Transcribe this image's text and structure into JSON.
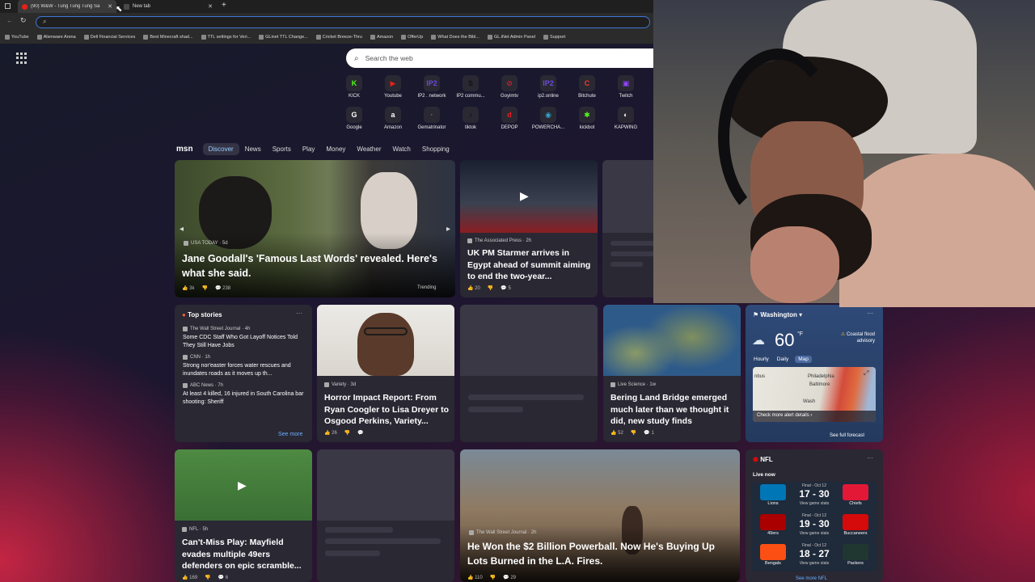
{
  "browser": {
    "tabs": [
      {
        "title": "(90) W&W - Tung Tung Tung Sa"
      },
      {
        "title": "New tab"
      }
    ],
    "bookmarks": [
      "YouTube",
      "Alienware Arena",
      "Dell Financial Services",
      "Best Minecraft shad...",
      "TTL settings for Veri...",
      "GLinet TTL Change...",
      "Cricket Breeze-Thru",
      "Amazon",
      "OfferUp",
      "What Does the Bibl...",
      "GL.iNet Admin Panel",
      "Support"
    ]
  },
  "search": {
    "placeholder": "Search the web"
  },
  "quick_links": [
    {
      "label": "KICK",
      "glyph": "K",
      "color": "#53fc18"
    },
    {
      "label": "Youtube",
      "glyph": "▶",
      "color": "#e62117"
    },
    {
      "label": "IP2 . network",
      "glyph": "IP2",
      "color": "#6b4bd6"
    },
    {
      "label": "IP2 commu...",
      "glyph": "S",
      "color": "#111111"
    },
    {
      "label": "Goyimtv",
      "glyph": "⊘",
      "color": "#cc2233"
    },
    {
      "label": "ip2.online",
      "glyph": "IP2",
      "color": "#6b4bd6"
    },
    {
      "label": "Bitchute",
      "glyph": "C",
      "color": "#ef3b2e"
    },
    {
      "label": "Twitch",
      "glyph": "▣",
      "color": "#9146ff"
    },
    {
      "label": "Google",
      "glyph": "G",
      "color": "#ffffff"
    },
    {
      "label": "Amazon",
      "glyph": "a",
      "color": "#ffffff"
    },
    {
      "label": "Gematrinator",
      "glyph": "·",
      "color": "#777777"
    },
    {
      "label": "tiktok",
      "glyph": "♪",
      "color": "#111111"
    },
    {
      "label": "DEPOP",
      "glyph": "d",
      "color": "#e8202a"
    },
    {
      "label": "POWERCHA...",
      "glyph": "◉",
      "color": "#2aa8c8"
    },
    {
      "label": "kickbot",
      "glyph": "✱",
      "color": "#53fc18"
    },
    {
      "label": "KAPWING",
      "glyph": "◐",
      "color": "#eeeeee"
    }
  ],
  "msn": {
    "logo": "msn",
    "nav": [
      "Discover",
      "News",
      "Sports",
      "Play",
      "Money",
      "Weather",
      "Watch",
      "Shopping"
    ],
    "active_nav": "Discover"
  },
  "cards": {
    "hero": {
      "source": "USA TODAY · 5d",
      "headline": "Jane Goodall's 'Famous Last Words' revealed. Here's what she said.",
      "likes": "3k",
      "comments": "238",
      "tag": "Trending"
    },
    "starmer": {
      "source": "The Associated Press · 2h",
      "headline": "UK PM Starmer arrives in Egypt ahead of summit aiming to end the two-year...",
      "likes": "20",
      "comments": "5"
    },
    "top_stories": {
      "title": "Top stories",
      "items": [
        {
          "source": "The Wall Street Journal · 4h",
          "headline": "Some CDC Staff Who Got Layoff Notices Told They Still Have Jobs"
        },
        {
          "source": "CNN · 1h",
          "headline": "Strong nor'easter forces water rescues and inundates roads as it moves up th..."
        },
        {
          "source": "ABC News · 7h",
          "headline": "At least 4 killed, 16 injured in South Carolina bar shooting: Sheriff"
        }
      ],
      "see_more": "See more"
    },
    "horror": {
      "source": "Variety · 3d",
      "headline": "Horror Impact Report: From Ryan Coogler to Lisa Dreyer to Osgood Perkins, Variety...",
      "likes": "26"
    },
    "bering": {
      "source": "Live Science · 1w",
      "headline": "Bering Land Bridge emerged much later than we thought it did, new study finds",
      "likes": "52",
      "comments": "1"
    },
    "weather": {
      "location": "Washington",
      "temp": "60",
      "unit": "°F",
      "alert": "Coastal flood advisory",
      "tabs": [
        "Hourly",
        "Daily",
        "Map"
      ],
      "active_tab": "Map",
      "map_labels": [
        "Philadelphia",
        "Baltimore",
        "Wash",
        "nbus"
      ],
      "alert_link": "Check more alert details",
      "forecast_link": "See full forecast"
    },
    "mayfield": {
      "source": "NFL · 5h",
      "headline": "Can't-Miss Play: Mayfield evades multiple 49ers defenders on epic scramble...",
      "likes": "169",
      "comments": "6"
    },
    "powerball": {
      "source": "The Wall Street Journal · 2h",
      "headline": "He Won the $2 Billion Powerball. Now He's Buying Up Lots Burned in the L.A. Fires.",
      "likes": "110",
      "comments": "29"
    },
    "nfl": {
      "title": "NFL",
      "live": "Live now",
      "games": [
        {
          "status": "Final - Oct 12",
          "score": "17 - 30",
          "link": "View game stats",
          "home": "Lions",
          "away": "Chiefs",
          "hc": "#0076b6",
          "ac": "#e31837"
        },
        {
          "status": "Final - Oct 12",
          "score": "19 - 30",
          "link": "View game stats",
          "home": "49ers",
          "away": "Buccaneers",
          "hc": "#aa0000",
          "ac": "#d50a0a"
        },
        {
          "status": "Final - Oct 12",
          "score": "18 - 27",
          "link": "View game stats",
          "home": "Bengals",
          "away": "Packers",
          "hc": "#fb4f14",
          "ac": "#203731"
        }
      ],
      "see_more": "See more NFL"
    }
  },
  "colors": {
    "accent": "#3d78d8",
    "card": "#2a2833",
    "skeleton": "#3a3845"
  }
}
